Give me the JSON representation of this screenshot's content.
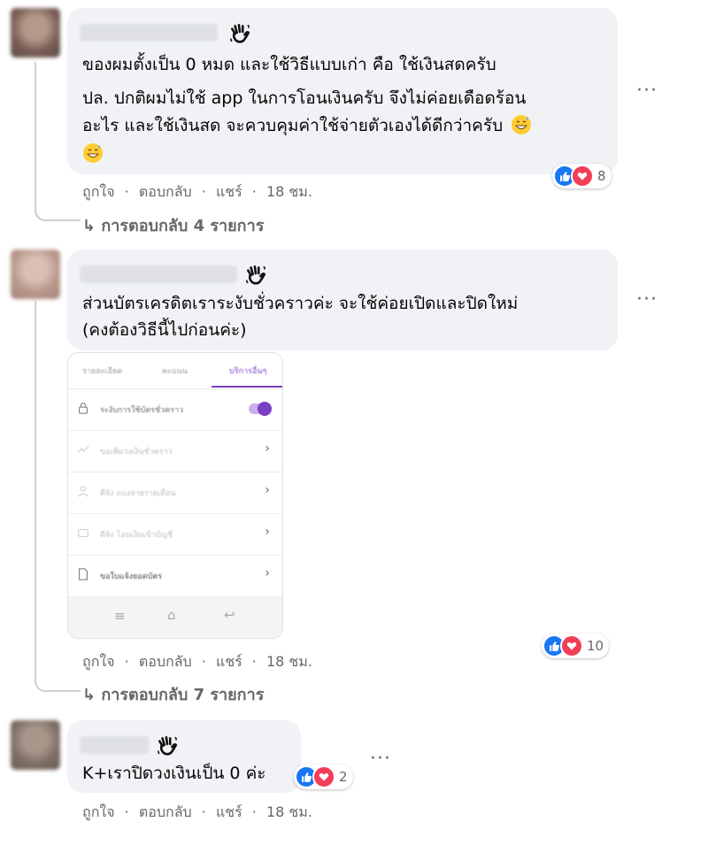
{
  "comments": [
    {
      "lines": [
        "ของผมตั้งเป็น 0 หมด และใช้วิธีแบบเก่า คือ ใช้เงินสดครับ",
        "ปล. ปกติผมไม่ใช้ app ในการโอนเงินครับ จึงไม่ค่อยเดือดร้อน",
        "อะไร และใช้เงินสด จะควบคุมค่าใช้จ่ายตัวเองได้ดีกว่าครับ"
      ],
      "reaction_count": "8",
      "like": "ถูกใจ",
      "reply": "ตอบกลับ",
      "share": "แชร์",
      "time": "18 ชม.",
      "replies_label": "↳ การตอบกลับ 4 รายการ"
    },
    {
      "lines": [
        "ส่วนบัตรเครดิตเราระงับชั่วคราวค่ะ จะใช้ค่อยเปิดและปิดใหม่",
        "(คงต้องวิธีนี้ไปก่อนค่ะ)"
      ],
      "reaction_count": "10",
      "like": "ถูกใจ",
      "reply": "ตอบกลับ",
      "share": "แชร์",
      "time": "18 ชม.",
      "replies_label": "↳ การตอบกลับ 7 รายการ",
      "attachment": {
        "tabs": [
          "รายละเอียด",
          "คะแนน",
          "บริการอื่นๆ"
        ],
        "rows": [
          "ระงับการใช้บัตรชั่วคราว",
          "ขอเพิ่มวงเงินชั่วคราว",
          "ดีจัง แบ่งจ่ายรายเดือน",
          "ดีจัง โอนเงินเข้าบัญชี",
          "ขอใบแจ้งยอดบัตร"
        ],
        "nav": [
          "≡",
          "⌂",
          "↩"
        ],
        "accent": "#7b3fc4"
      }
    },
    {
      "lines": [
        "K+เราปิดวงเงินเป็น 0 ค่ะ"
      ],
      "reaction_count": "2",
      "like": "ถูกใจ",
      "reply": "ตอบกลับ",
      "share": "แชร์",
      "time": "18 ชม."
    }
  ],
  "more_label": "···",
  "separator": "·",
  "colors": {
    "like_blue": "#1877f2",
    "love_red": "#f33e58",
    "bubble": "#f0f2f5",
    "meta": "#65676b"
  },
  "icons": [
    "wave-hand-icon",
    "like-reaction-icon",
    "love-reaction-icon",
    "grin-sweat-emoji",
    "lock-icon",
    "chevron-right-icon"
  ]
}
